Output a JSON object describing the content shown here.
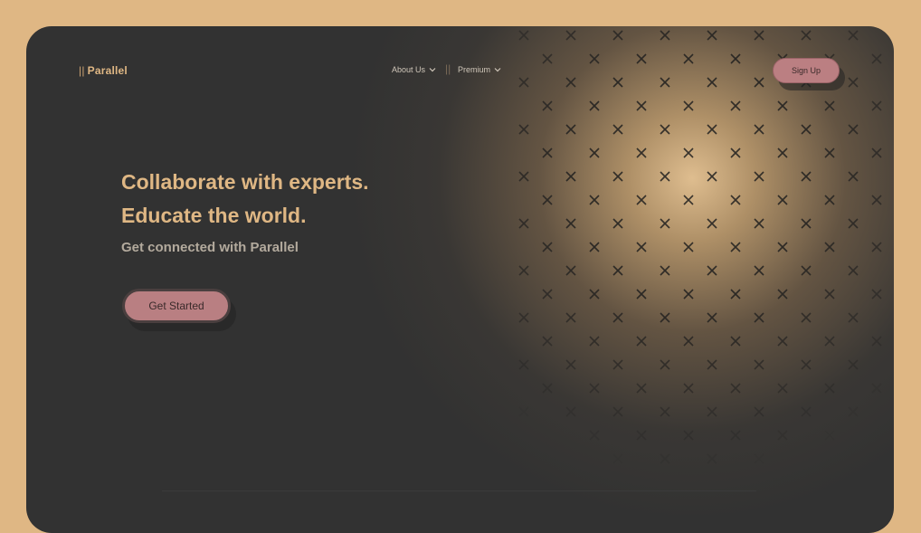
{
  "brand": {
    "name": "Parallel",
    "mark": "||"
  },
  "nav": {
    "items": [
      {
        "label": "About Us",
        "icon": "chevron-down-icon"
      },
      {
        "label": "Premium",
        "icon": "chevron-down-icon"
      }
    ],
    "divider": "||",
    "signup_label": "Sign Up"
  },
  "hero": {
    "title_line1": "Collaborate with experts.",
    "title_line2": "Educate the world.",
    "subtitle": "Get connected with Parallel",
    "cta_label": "Get Started"
  },
  "colors": {
    "frame": "#dfb784",
    "background": "#323232",
    "accent": "#dfb784",
    "button": "#bb7f82"
  },
  "decoration": {
    "pattern_icon": "x-mark-icon"
  }
}
